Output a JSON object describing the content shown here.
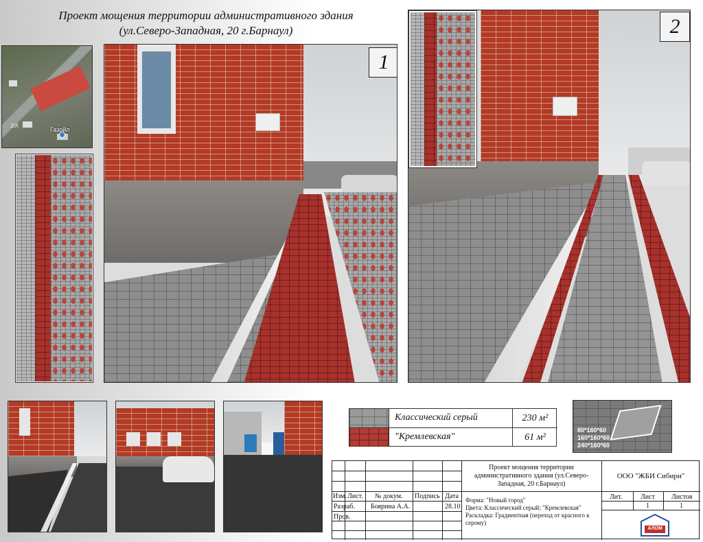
{
  "title": {
    "line1": "Проект мощения территории административного здания",
    "line2": "(ул.Северо-Западная, 20 г.Барнаул)"
  },
  "map": {
    "poi_label": "Газойл",
    "number_label": "2/А"
  },
  "views": [
    {
      "number": "1"
    },
    {
      "number": "2"
    }
  ],
  "legend": [
    {
      "name": "Классический серый",
      "area": "230 м²",
      "color": "#9a9a9a"
    },
    {
      "name": "\"Кремлевская\"",
      "area": "61 м²",
      "color": "#b23b33"
    }
  ],
  "tile_sizes": [
    "80*160*60",
    "160*160*60",
    "240*160*60"
  ],
  "stamp": {
    "project_title": "Проект мощения территории административного здания (ул.Северо-Западная, 20 г.Барнаул)",
    "company": "ООО \"ЖБИ Сибири\"",
    "headers": [
      "Изм.",
      "Лист.",
      "№ докум.",
      "Подпись",
      "Дата"
    ],
    "rows": [
      {
        "role": "Разраб.",
        "name": "Боярина А.А.",
        "date": "28.10"
      },
      {
        "role": "Пров.",
        "name": "",
        "date": ""
      }
    ],
    "form": "Форма: \"Новый город\"",
    "colors": "Цвета: Классический серый; \"Кремлевская\"",
    "layout": "Раскладка: Градиентная (переход от красного к серому)",
    "lit_label": "Лит.",
    "sheet_label": "Лист",
    "sheets_label": "Листов",
    "sheet_value": "1",
    "sheets_value": "1",
    "logo_text": "АЛОМ"
  }
}
